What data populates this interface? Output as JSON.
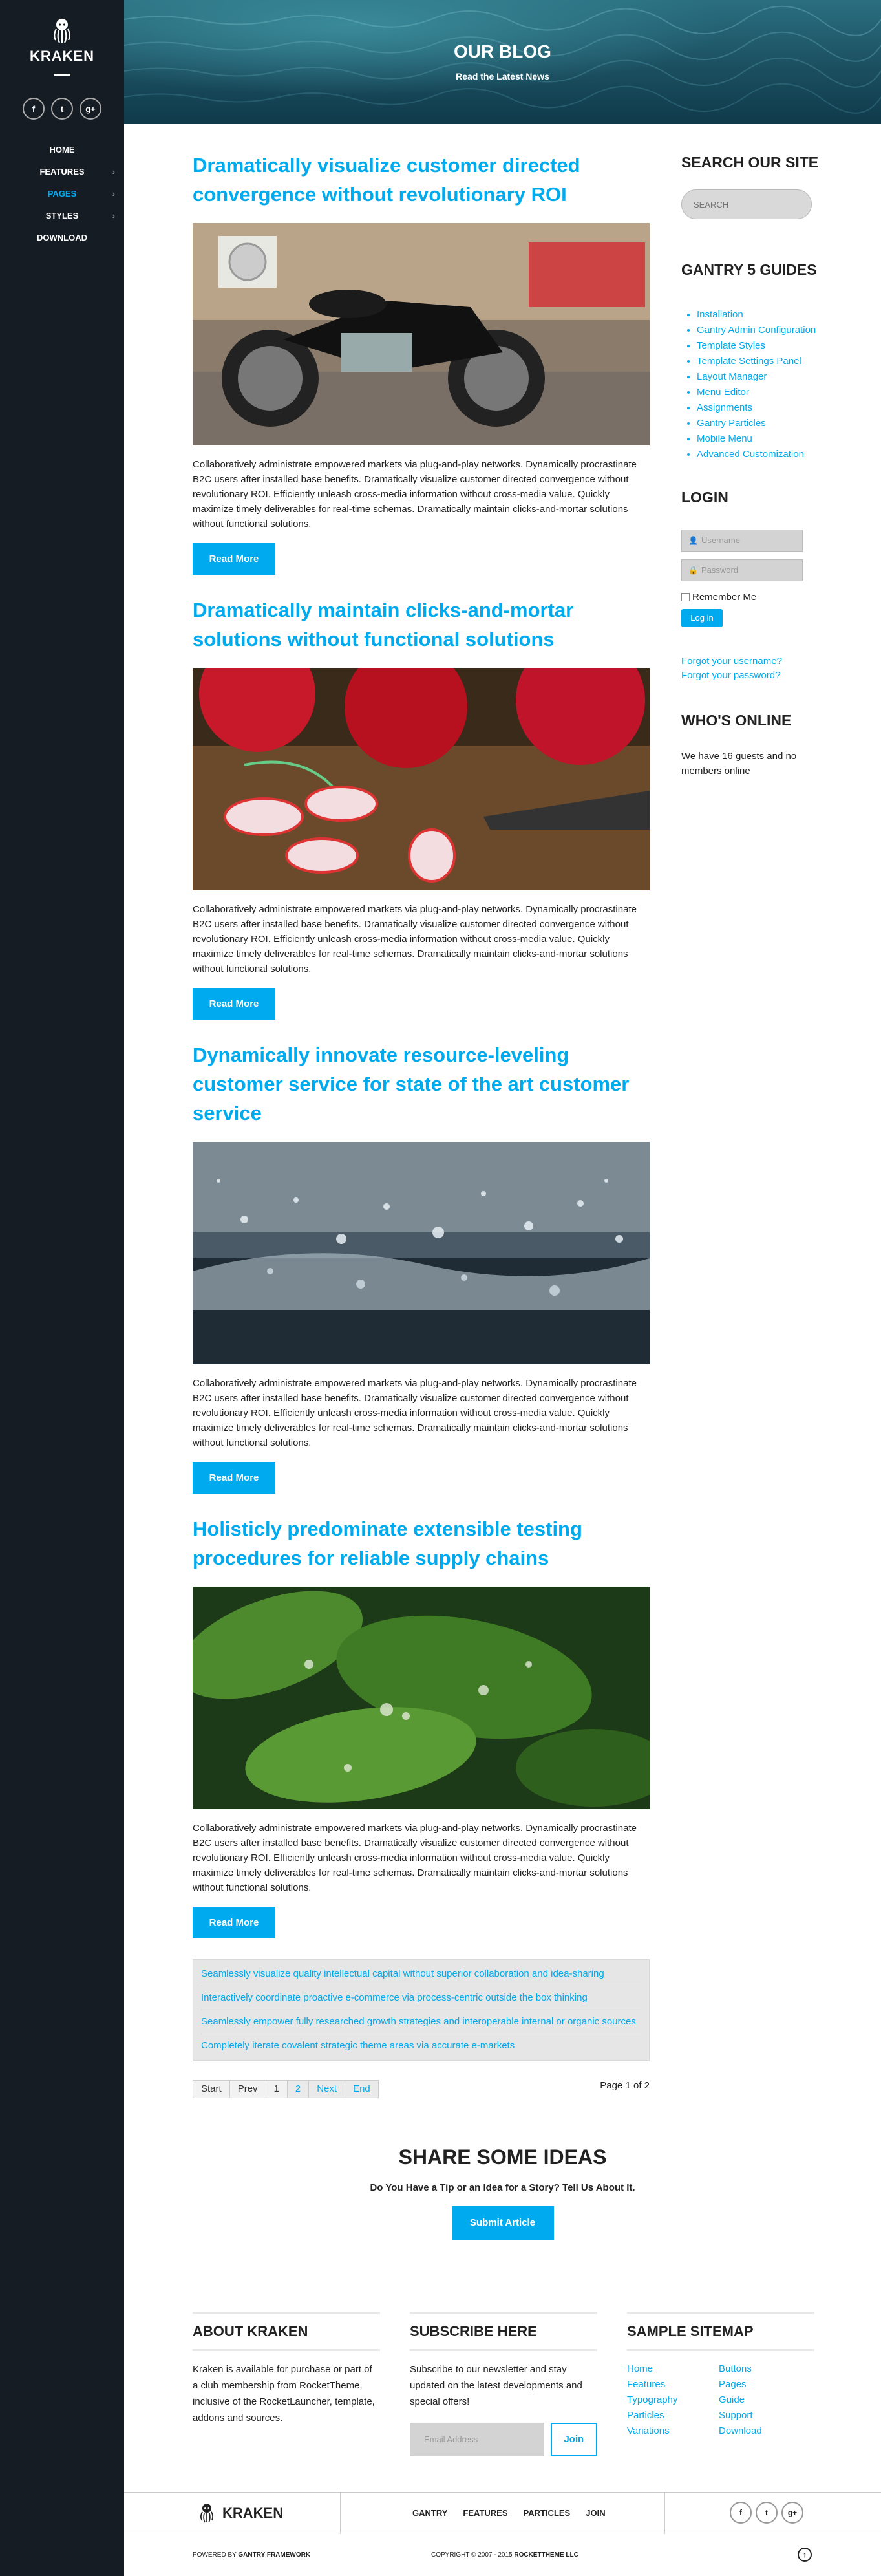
{
  "brand": {
    "name": "KRAKEN"
  },
  "sidebar": {
    "social": [
      {
        "icon": "facebook-icon",
        "glyph": "f"
      },
      {
        "icon": "twitter-icon",
        "glyph": "t"
      },
      {
        "icon": "googleplus-icon",
        "glyph": "g+"
      }
    ],
    "nav": [
      {
        "label": "HOME",
        "has_children": false,
        "active": false
      },
      {
        "label": "FEATURES",
        "has_children": true,
        "active": false
      },
      {
        "label": "PAGES",
        "has_children": true,
        "active": true
      },
      {
        "label": "STYLES",
        "has_children": true,
        "active": false
      },
      {
        "label": "DOWNLOAD",
        "has_children": false,
        "active": false
      }
    ]
  },
  "hero": {
    "title": "OUR BLOG",
    "subtitle": "Read the Latest News"
  },
  "posts": [
    {
      "title": "Dramatically visualize customer directed convergence without revolutionary ROI",
      "body": "Collaboratively administrate empowered markets via plug-and-play networks. Dynamically procrastinate B2C users after installed base benefits. Dramatically visualize customer directed convergence without revolutionary ROI. Efficiently unleash cross-media information without cross-media value. Quickly maximize timely deliverables for real-time schemas. Dramatically maintain clicks-and-mortar solutions without functional solutions.",
      "read_more": "Read More",
      "image": "motorcycle"
    },
    {
      "title": "Dramatically maintain clicks-and-mortar solutions without functional solutions",
      "body": "Collaboratively administrate empowered markets via plug-and-play networks. Dynamically procrastinate B2C users after installed base benefits. Dramatically visualize customer directed convergence without revolutionary ROI. Efficiently unleash cross-media information without cross-media value. Quickly maximize timely deliverables for real-time schemas. Dramatically maintain clicks-and-mortar solutions without functional solutions.",
      "read_more": "Read More",
      "image": "radishes"
    },
    {
      "title": "Dynamically innovate resource-leveling customer service for state of the art customer service",
      "body": "Collaboratively administrate empowered markets via plug-and-play networks. Dynamically procrastinate B2C users after installed base benefits. Dramatically visualize customer directed convergence without revolutionary ROI. Efficiently unleash cross-media information without cross-media value. Quickly maximize timely deliverables for real-time schemas. Dramatically maintain clicks-and-mortar solutions without functional solutions.",
      "read_more": "Read More",
      "image": "water-splash"
    },
    {
      "title": "Holisticly predominate extensible testing procedures for reliable supply chains",
      "body": "Collaboratively administrate empowered markets via plug-and-play networks. Dynamically procrastinate B2C users after installed base benefits. Dramatically visualize customer directed convergence without revolutionary ROI. Efficiently unleash cross-media information without cross-media value. Quickly maximize timely deliverables for real-time schemas. Dramatically maintain clicks-and-mortar solutions without functional solutions.",
      "read_more": "Read More",
      "image": "green-leaves"
    }
  ],
  "more_links": [
    "Seamlessly visualize quality intellectual capital without superior collaboration and idea-sharing",
    "Interactively coordinate proactive e-commerce via process-centric outside the box thinking",
    "Seamlessly empower fully researched growth strategies and interoperable internal or organic sources",
    "Completely iterate covalent strategic theme areas via accurate e-markets"
  ],
  "pagination": {
    "start": "Start",
    "prev": "Prev",
    "page1": "1",
    "page2": "2",
    "next": "Next",
    "end": "End",
    "counter": "Page 1 of 2"
  },
  "aside": {
    "search_title": "SEARCH OUR SITE",
    "search_placeholder": "SEARCH",
    "guides_title": "GANTRY 5 GUIDES",
    "guides": [
      "Installation",
      "Gantry Admin Configuration",
      "Template Styles",
      "Template Settings Panel",
      "Layout Manager",
      "Menu Editor",
      "Assignments",
      "Gantry Particles",
      "Mobile Menu",
      "Advanced Customization"
    ],
    "login_title": "LOGIN",
    "username_placeholder": "Username",
    "password_placeholder": "Password",
    "remember_label": "Remember Me",
    "login_button": "Log in",
    "forgot_username": "Forgot your username?",
    "forgot_password": "Forgot your password?",
    "online_title": "WHO'S ONLINE",
    "online_text": "We have 16 guests and no members online"
  },
  "share": {
    "title": "SHARE SOME IDEAS",
    "subtitle": "Do You Have a Tip or an Idea for a Story? Tell Us About It.",
    "button": "Submit Article"
  },
  "footer": {
    "about_title": "ABOUT KRAKEN",
    "about_text": "Kraken is available for purchase or part of a club membership from RocketTheme, inclusive of the RocketLauncher, template, addons and sources.",
    "subscribe_title": "SUBSCRIBE HERE",
    "subscribe_text": "Subscribe to our newsletter and stay updated on the latest developments and special offers!",
    "email_placeholder": "Email Address",
    "join_button": "Join",
    "sitemap_title": "SAMPLE SITEMAP",
    "sitemap_col1": [
      "Home",
      "Features",
      "Typography",
      "Particles",
      "Variations"
    ],
    "sitemap_col2": [
      "Buttons",
      "Pages",
      "Guide",
      "Support",
      "Download"
    ]
  },
  "bottom": {
    "logo": "KRAKEN",
    "nav": [
      "GANTRY",
      "FEATURES",
      "PARTICLES",
      "JOIN"
    ],
    "powered_prefix": "POWERED BY ",
    "powered_by": "GANTRY FRAMEWORK",
    "copyright_prefix": "COPYRIGHT © 2007 - 2015 ",
    "copyright_owner": "ROCKETTHEME LLC"
  },
  "colors": {
    "accent": "#00aaee",
    "sidebar": "#161c24"
  }
}
